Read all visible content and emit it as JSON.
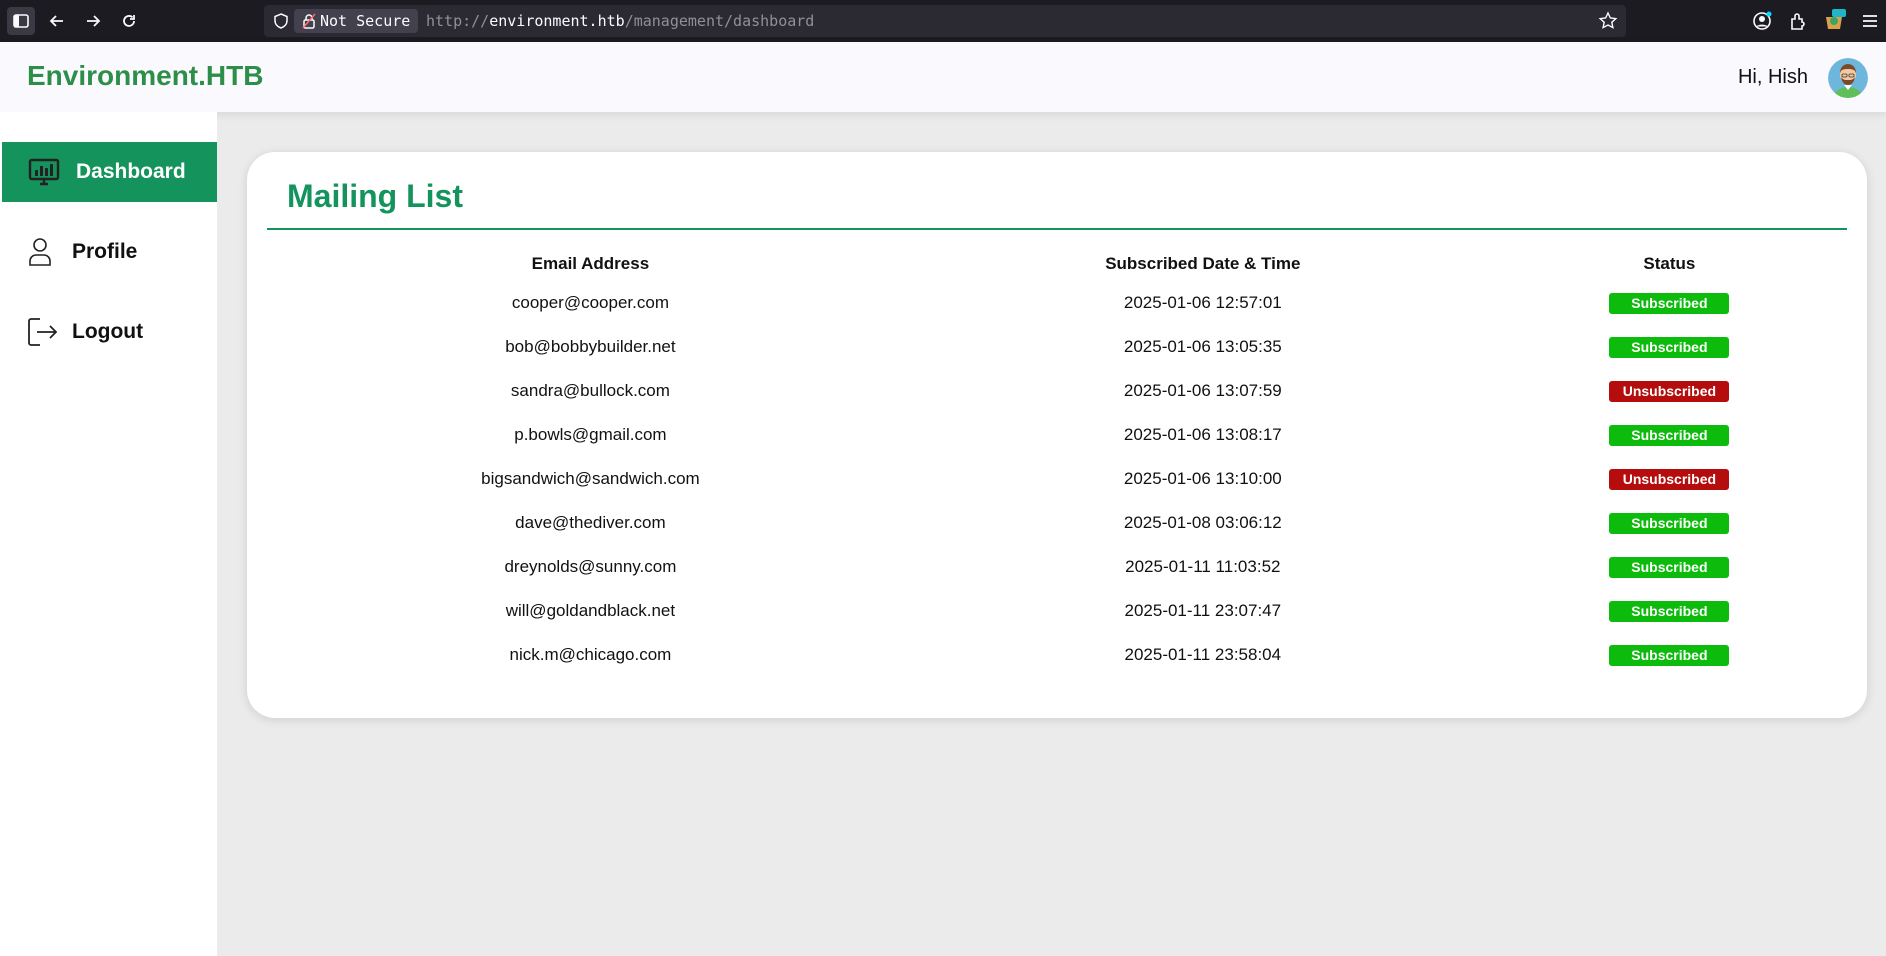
{
  "browser": {
    "security_label": "Not Secure",
    "url_scheme": "http://",
    "url_host": "environment.htb",
    "url_path": "/management/dashboard",
    "icons": [
      "sidebar-icon",
      "back-arrow-icon",
      "forward-arrow-icon",
      "reload-icon",
      "shield-icon",
      "lock-icon",
      "star-icon",
      "account-icon",
      "extensions-icon",
      "extension-badge-icon",
      "menu-icon"
    ]
  },
  "header": {
    "brand": "Environment.HTB",
    "greeting": "Hi, Hish",
    "brand_color": "#2d8e4a"
  },
  "sidebar": {
    "items": [
      {
        "label": "Dashboard",
        "icon": "dashboard-monitor-icon",
        "active": true
      },
      {
        "label": "Profile",
        "icon": "user-icon",
        "active": false
      },
      {
        "label": "Logout",
        "icon": "logout-icon",
        "active": false
      }
    ],
    "active_color": "#14935d"
  },
  "main": {
    "title": "Mailing List",
    "columns": [
      "Email Address",
      "Subscribed Date & Time",
      "Status"
    ],
    "rows": [
      {
        "email": "cooper@cooper.com",
        "date": "2025-01-06 12:57:01",
        "status": "Subscribed"
      },
      {
        "email": "bob@bobbybuilder.net",
        "date": "2025-01-06 13:05:35",
        "status": "Subscribed"
      },
      {
        "email": "sandra@bullock.com",
        "date": "2025-01-06 13:07:59",
        "status": "Unsubscribed"
      },
      {
        "email": "p.bowls@gmail.com",
        "date": "2025-01-06 13:08:17",
        "status": "Subscribed"
      },
      {
        "email": "bigsandwich@sandwich.com",
        "date": "2025-01-06 13:10:00",
        "status": "Unsubscribed"
      },
      {
        "email": "dave@thediver.com",
        "date": "2025-01-08 03:06:12",
        "status": "Subscribed"
      },
      {
        "email": "dreynolds@sunny.com",
        "date": "2025-01-11 11:03:52",
        "status": "Subscribed"
      },
      {
        "email": "will@goldandblack.net",
        "date": "2025-01-11 23:07:47",
        "status": "Subscribed"
      },
      {
        "email": "nick.m@chicago.com",
        "date": "2025-01-11 23:58:04",
        "status": "Subscribed"
      }
    ],
    "status_colors": {
      "Subscribed": "#0dbb0d",
      "Unsubscribed": "#b50d0d"
    }
  }
}
